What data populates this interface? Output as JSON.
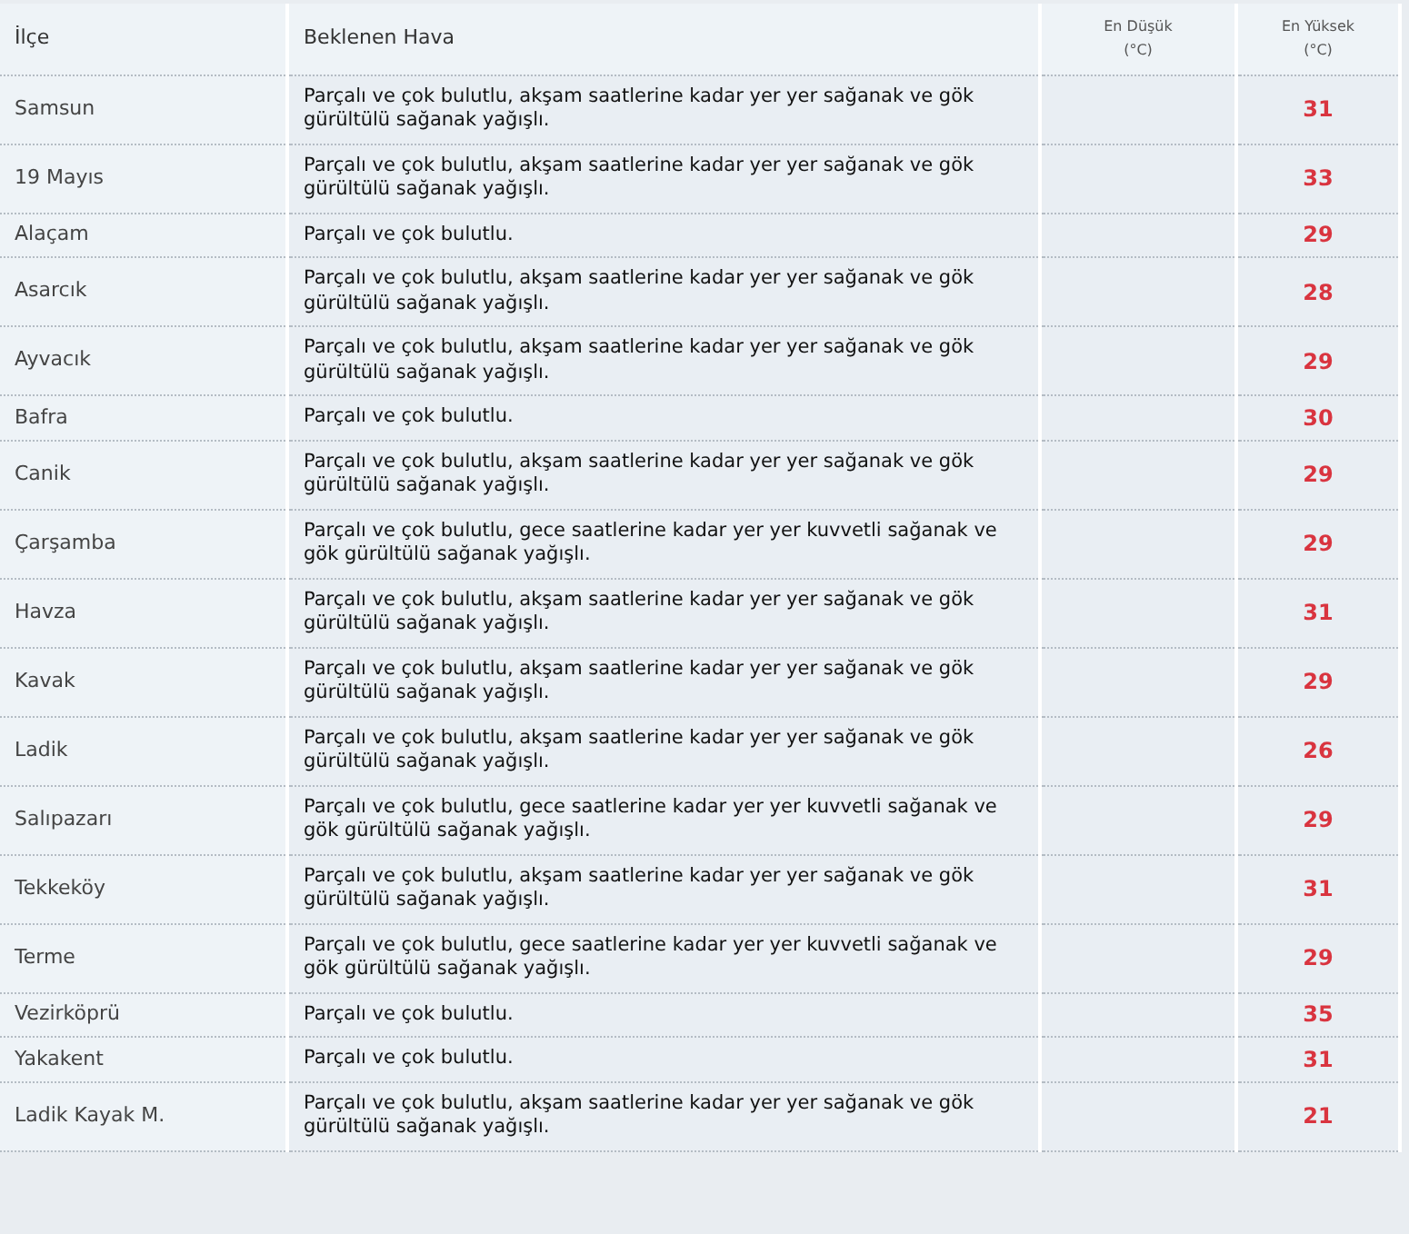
{
  "table": {
    "columns": [
      "İlçe",
      "Beklenen Hava",
      "En Düşük\n(°C)",
      "En Yüksek\n(°C)"
    ],
    "rows": [
      {
        "district": "Samsun",
        "forecast": "Parçalı ve çok bulutlu, akşam saatlerine kadar yer yer sağanak ve gök gürültülü sağanak yağışlı.",
        "high": "31"
      },
      {
        "district": "19 Mayıs",
        "forecast": "Parçalı ve çok bulutlu, akşam saatlerine kadar yer yer sağanak ve gök gürültülü sağanak yağışlı.",
        "high": "33"
      },
      {
        "district": "Alaçam",
        "forecast": "Parçalı ve çok bulutlu.",
        "high": "29"
      },
      {
        "district": "Asarcık",
        "forecast": "Parçalı ve çok bulutlu, akşam saatlerine kadar yer yer sağanak ve gök gürültülü sağanak yağışlı.",
        "high": "28"
      },
      {
        "district": "Ayvacık",
        "forecast": "Parçalı ve çok bulutlu, akşam saatlerine kadar yer yer sağanak ve gök gürültülü sağanak yağışlı.",
        "high": "29"
      },
      {
        "district": "Bafra",
        "forecast": "Parçalı ve çok bulutlu.",
        "high": "30"
      },
      {
        "district": "Canik",
        "forecast": "Parçalı ve çok bulutlu, akşam saatlerine kadar yer yer sağanak ve gök gürültülü sağanak yağışlı.",
        "high": "29"
      },
      {
        "district": "Çarşamba",
        "forecast": "Parçalı ve çok bulutlu, gece saatlerine kadar yer yer kuvvetli sağanak ve gök gürültülü sağanak yağışlı.",
        "high": "29"
      },
      {
        "district": "Havza",
        "forecast": "Parçalı ve çok bulutlu, akşam saatlerine kadar yer yer sağanak ve gök gürültülü sağanak yağışlı.",
        "high": "31"
      },
      {
        "district": "Kavak",
        "forecast": "Parçalı ve çok bulutlu, akşam saatlerine kadar yer yer sağanak ve gök gürültülü sağanak yağışlı.",
        "high": "29"
      },
      {
        "district": "Ladik",
        "forecast": "Parçalı ve çok bulutlu, akşam saatlerine kadar yer yer sağanak ve gök gürültülü sağanak yağışlı.",
        "high": "26"
      },
      {
        "district": "Salıpazarı",
        "forecast": "Parçalı ve çok bulutlu, gece saatlerine kadar yer yer kuvvetli sağanak ve gök gürültülü sağanak yağışlı.",
        "high": "29"
      },
      {
        "district": "Tekkeköy",
        "forecast": "Parçalı ve çok bulutlu, akşam saatlerine kadar yer yer sağanak ve gök gürültülü sağanak yağışlı.",
        "high": "31"
      },
      {
        "district": "Terme",
        "forecast": "Parçalı ve çok bulutlu, gece saatlerine kadar yer yer kuvvetli sağanak ve gök gürültülü sağanak yağışlı.",
        "high": "29"
      },
      {
        "district": "Vezirköprü",
        "forecast": "Parçalı ve çok bulutlu.",
        "high": "35"
      },
      {
        "district": "Yakakent",
        "forecast": "Parçalı ve çok bulutlu.",
        "high": "31"
      },
      {
        "district": "Ladik Kayak M.",
        "forecast": "Parçalı ve çok bulutlu, akşam saatlerine kadar yer yer sağanak ve gök gürültülü sağanak yağışlı.",
        "high": "21"
      }
    ]
  }
}
